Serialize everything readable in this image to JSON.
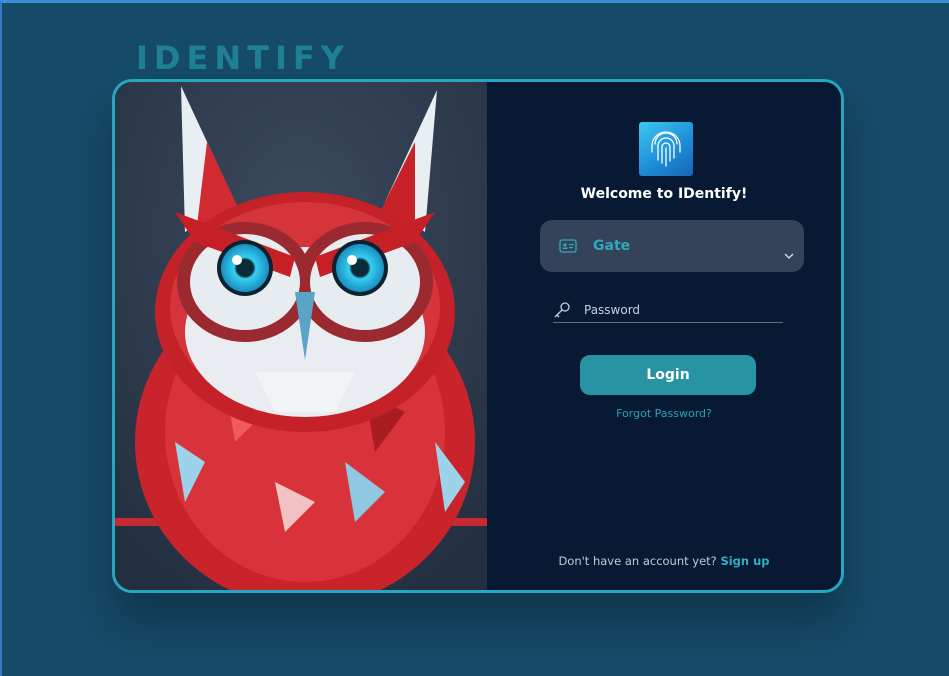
{
  "brand": {
    "name": "IDENTIFY"
  },
  "illustration": {
    "subject": "owl-illustration",
    "colors": {
      "feathers": "#d9272e",
      "eyes": "#2fc6ea",
      "face": "#e9eef2",
      "background": "#2c3b4f"
    }
  },
  "login_panel": {
    "logo_icon": "fingerprint-icon",
    "welcome": "Welcome to IDentify!",
    "gate_select": {
      "icon": "id-card-icon",
      "value": "Gate",
      "chevron": "chevron-down-icon"
    },
    "password": {
      "icon": "key-icon",
      "placeholder": "Password",
      "value": ""
    },
    "login_button": "Login",
    "forgot_link": "Forgot Password?",
    "signup_prompt": "Don't have an account yet?",
    "signup_link": "Sign up"
  },
  "colors": {
    "page_bg": "#154a68",
    "panel_bg": "#081933",
    "accent": "#2793a3",
    "card_border": "#29a6bf",
    "select_bg": "#34435a"
  }
}
